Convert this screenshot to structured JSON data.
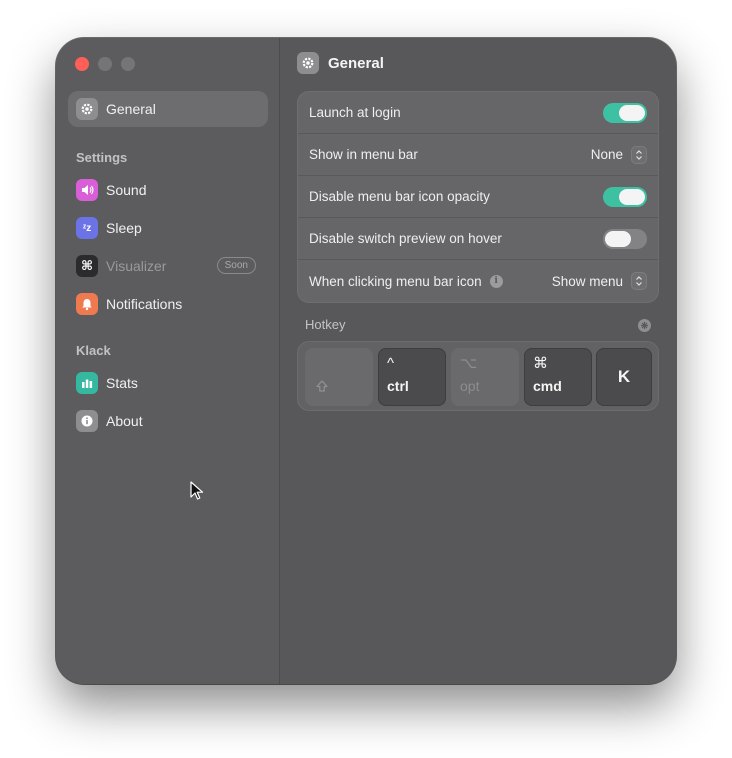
{
  "sidebar": {
    "general_label": "General",
    "settings_section": "Settings",
    "items": [
      {
        "label": "Sound",
        "icon": "speaker-icon",
        "color": "#d85fd8"
      },
      {
        "label": "Sleep",
        "icon": "zzz-icon",
        "color": "#6b73e6"
      },
      {
        "label": "Visualizer",
        "icon": "command-icon",
        "color": "#2b2b2d",
        "badge": "Soon"
      },
      {
        "label": "Notifications",
        "icon": "bell-icon",
        "color": "#f07a50"
      }
    ],
    "klack_section": "Klack",
    "klack_items": [
      {
        "label": "Stats",
        "icon": "bar-chart-icon",
        "color": "#34b8a0"
      },
      {
        "label": "About",
        "icon": "info-icon",
        "color": "#8e8e90"
      }
    ]
  },
  "main": {
    "title": "General",
    "settings": [
      {
        "label": "Launch at login",
        "type": "toggle",
        "on": true
      },
      {
        "label": "Show in menu bar",
        "type": "select",
        "value": "None"
      },
      {
        "label": "Disable menu bar icon opacity",
        "type": "toggle",
        "on": true
      },
      {
        "label": "Disable switch preview on hover",
        "type": "toggle",
        "on": false
      },
      {
        "label": "When clicking menu bar icon",
        "type": "select",
        "value": "Show menu",
        "info_glyph": "i"
      }
    ],
    "hotkey": {
      "label": "Hotkey",
      "keys": [
        {
          "symbol": "",
          "label": "",
          "pressed": false,
          "icon": "shift-icon"
        },
        {
          "symbol": "^",
          "label": "ctrl",
          "pressed": true
        },
        {
          "symbol": "⌥",
          "label": "opt",
          "pressed": false
        },
        {
          "symbol": "⌘",
          "label": "cmd",
          "pressed": true
        },
        {
          "symbol": "",
          "label": "K",
          "pressed": true
        }
      ]
    }
  },
  "colors": {
    "accent_toggle": "#3dc1a2",
    "close_light": "#ff5f57"
  }
}
